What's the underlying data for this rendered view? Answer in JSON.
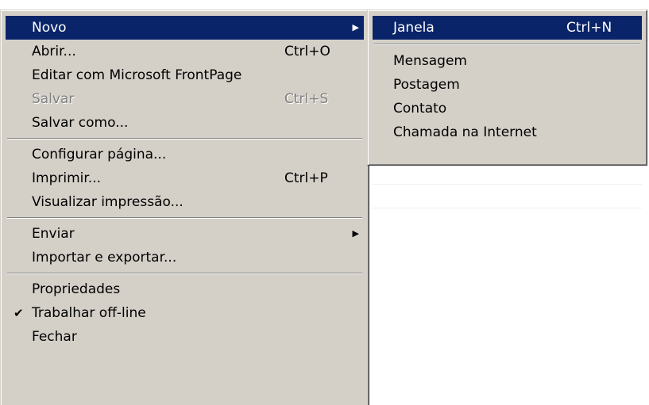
{
  "file_menu": {
    "items": [
      {
        "label": "Novo",
        "shortcut": "",
        "submenu_arrow": "▶"
      },
      {
        "label": "Abrir...",
        "shortcut": "Ctrl+O"
      },
      {
        "label": "Editar com Microsoft FrontPage",
        "shortcut": ""
      },
      {
        "label": "Salvar",
        "shortcut": "Ctrl+S",
        "disabled": true
      },
      {
        "label": "Salvar como...",
        "shortcut": ""
      },
      {
        "label": "Configurar página...",
        "shortcut": ""
      },
      {
        "label": "Imprimir...",
        "shortcut": "Ctrl+P"
      },
      {
        "label": "Visualizar impressão...",
        "shortcut": ""
      },
      {
        "label": "Enviar",
        "shortcut": "",
        "submenu_arrow": "▶"
      },
      {
        "label": "Importar e exportar...",
        "shortcut": ""
      },
      {
        "label": "Propriedades",
        "shortcut": ""
      },
      {
        "label": "Trabalhar off-line",
        "shortcut": "",
        "checked": true,
        "check_mark": "✔"
      },
      {
        "label": "Fechar",
        "shortcut": ""
      }
    ]
  },
  "novo_submenu": {
    "items": [
      {
        "label": "Janela",
        "shortcut": "Ctrl+N"
      },
      {
        "label": "Mensagem",
        "shortcut": ""
      },
      {
        "label": "Postagem",
        "shortcut": ""
      },
      {
        "label": "Contato",
        "shortcut": ""
      },
      {
        "label": "Chamada na Internet",
        "shortcut": ""
      }
    ]
  },
  "colors": {
    "menu_background": "#d4d0c8",
    "highlight": "#0a246a",
    "highlight_text": "#ffffff",
    "disabled_text": "#808080"
  },
  "icons": {
    "submenu_arrow": "triangle-right-icon",
    "check": "checkmark-icon"
  }
}
